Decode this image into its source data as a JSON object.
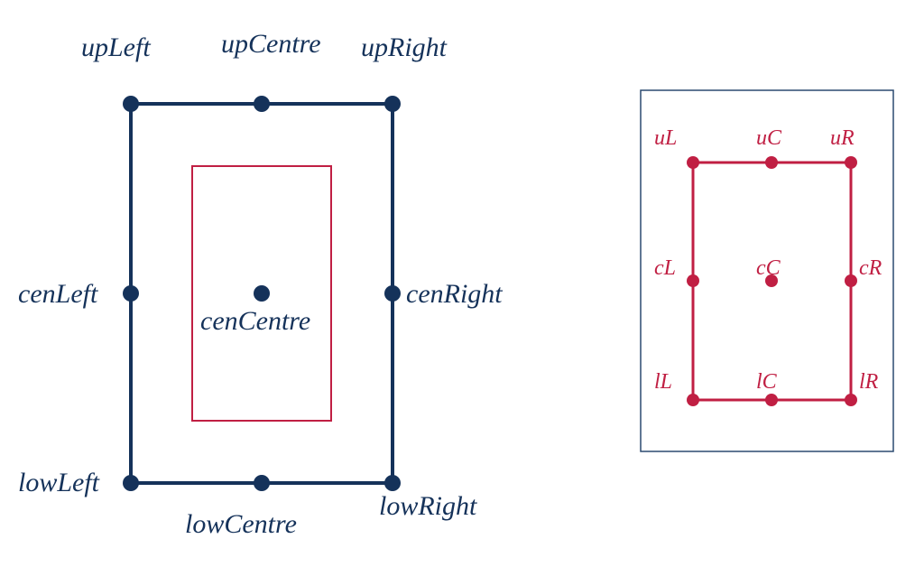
{
  "colors": {
    "navy": "#15325a",
    "red": "#c01f43",
    "thinNavy": "#2b4a70"
  },
  "leftDiagram": {
    "labels": {
      "upLeft": "upLeft",
      "upCentre": "upCentre",
      "upRight": "upRight",
      "cenLeft": "cenLeft",
      "cenCentre": "cenCentre",
      "cenRight": "cenRight",
      "lowLeft": "lowLeft",
      "lowCentre": "lowCentre",
      "lowRight": "lowRight"
    }
  },
  "rightDiagram": {
    "labels": {
      "uL": "uL",
      "uC": "uC",
      "uR": "uR",
      "cL": "cL",
      "cC": "cC",
      "cR": "cR",
      "lL": "lL",
      "lC": "lC",
      "lR": "lR"
    }
  }
}
